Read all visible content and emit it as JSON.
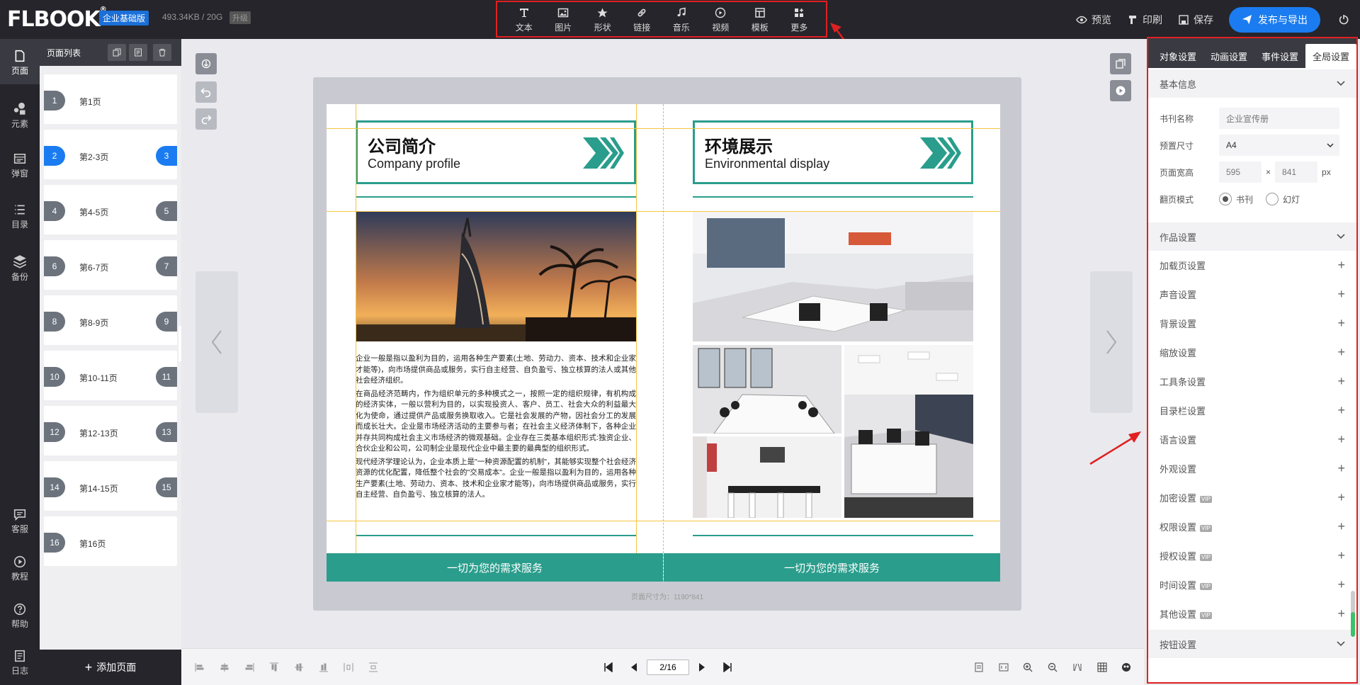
{
  "app": {
    "logo": "FLBOOK",
    "edition": "企业基础版",
    "storage": "493.34KB / 20G",
    "upgrade": "升级"
  },
  "toolbar": [
    {
      "label": "文本",
      "icon": "text-icon"
    },
    {
      "label": "图片",
      "icon": "image-icon"
    },
    {
      "label": "形状",
      "icon": "star-icon"
    },
    {
      "label": "链接",
      "icon": "link-icon"
    },
    {
      "label": "音乐",
      "icon": "music-icon"
    },
    {
      "label": "视频",
      "icon": "play-icon"
    },
    {
      "label": "模板",
      "icon": "template-icon"
    },
    {
      "label": "更多",
      "icon": "more-icon"
    }
  ],
  "topright": {
    "preview": "预览",
    "print": "印刷",
    "save": "保存",
    "publish": "发布与导出"
  },
  "leftnav": [
    {
      "label": "页面",
      "icon": "page-icon"
    },
    {
      "label": "元素",
      "icon": "element-icon"
    },
    {
      "label": "弹窗",
      "icon": "popup-icon"
    },
    {
      "label": "目录",
      "icon": "toc-icon"
    },
    {
      "label": "备份",
      "icon": "backup-icon"
    },
    {
      "label": "客服",
      "icon": "chat-icon"
    },
    {
      "label": "教程",
      "icon": "tutorial-icon"
    },
    {
      "label": "帮助",
      "icon": "help-icon"
    },
    {
      "label": "日志",
      "icon": "log-icon"
    }
  ],
  "pagelist": {
    "title": "页面列表",
    "add_page": "添加页面",
    "pages": [
      {
        "label": "第1页",
        "left": "1",
        "right": ""
      },
      {
        "label": "第2-3页",
        "left": "2",
        "right": "3"
      },
      {
        "label": "第4-5页",
        "left": "4",
        "right": "5"
      },
      {
        "label": "第6-7页",
        "left": "6",
        "right": "7"
      },
      {
        "label": "第8-9页",
        "left": "8",
        "right": "9"
      },
      {
        "label": "第10-11页",
        "left": "10",
        "right": "11"
      },
      {
        "label": "第12-13页",
        "left": "12",
        "right": "13"
      },
      {
        "label": "第14-15页",
        "left": "14",
        "right": "15"
      },
      {
        "label": "第16页",
        "left": "16",
        "right": ""
      }
    ]
  },
  "book": {
    "left": {
      "title_cn": "公司简介",
      "title_en": "Company profile",
      "paragraphs": [
        "企业一般是指以盈利为目的，运用各种生产要素(土地、劳动力、资本、技术和企业家才能等)，向市场提供商品或服务，实行自主经营、自负盈亏、独立核算的法人或其他社会经济组织。",
        "在商品经济范畴内，作为组织单元的多种模式之一，按照一定的组织规律，有机构成的经济实体，一般以营利为目的，以实现投资人、客户、员工、社会大众的利益最大化为使命，通过提供产品或服务换取收入。它是社会发展的产物，因社会分工的发展而成长壮大。企业是市场经济活动的主要参与者；在社会主义经济体制下，各种企业并存共同构成社会主义市场经济的微观基础。企业存在三类基本组织形式:独资企业、合伙企业和公司，公司制企业是现代企业中最主要的最典型的组织形式。",
        "现代经济学理论认为，企业本质上是\"一种资源配置的机制\"，其能够实现整个社会经济资源的优化配置，降低整个社会的\"交易成本\"。企业一般是指以盈利为目的，运用各种生产要素(土地、劳动力、资本、技术和企业家才能等)，向市场提供商品或服务，实行自主经营、自负盈亏、独立核算的法人。"
      ],
      "footer": "一切为您的需求服务"
    },
    "right": {
      "title_cn": "环境展示",
      "title_en": "Environmental display",
      "footer": "一切为您的需求服务"
    },
    "size_note": "页面尺寸为：1190*841"
  },
  "pager": {
    "current": "2/16"
  },
  "rightpanel": {
    "tabs": [
      "对象设置",
      "动画设置",
      "事件设置",
      "全局设置"
    ],
    "active_tab": 3,
    "basic_section": "基本信息",
    "fields": {
      "book_name_label": "书刊名称",
      "book_name_placeholder": "企业宣传册",
      "preset_size_label": "预置尺寸",
      "preset_size_value": "A4",
      "page_size_label": "页面宽高",
      "width": "595",
      "times": "×",
      "height": "841",
      "unit": "px",
      "flip_mode_label": "翻页模式",
      "flip_book": "书刊",
      "flip_slide": "幻灯"
    },
    "work_section": "作品设置",
    "items": [
      {
        "label": "加载页设置",
        "vip": false
      },
      {
        "label": "声音设置",
        "vip": false
      },
      {
        "label": "背景设置",
        "vip": false
      },
      {
        "label": "缩放设置",
        "vip": false
      },
      {
        "label": "工具条设置",
        "vip": false
      },
      {
        "label": "目录栏设置",
        "vip": false
      },
      {
        "label": "语言设置",
        "vip": false
      },
      {
        "label": "外观设置",
        "vip": false
      },
      {
        "label": "加密设置",
        "vip": true
      },
      {
        "label": "权限设置",
        "vip": true
      },
      {
        "label": "授权设置",
        "vip": true
      },
      {
        "label": "时间设置",
        "vip": true
      },
      {
        "label": "其他设置",
        "vip": true
      }
    ],
    "vip_tag": "VIP",
    "button_section": "按钮设置"
  },
  "colors": {
    "accent": "#1a7cf0",
    "teal": "#2a9d8c",
    "highlight": "#e02020",
    "dark": "#25252b"
  }
}
